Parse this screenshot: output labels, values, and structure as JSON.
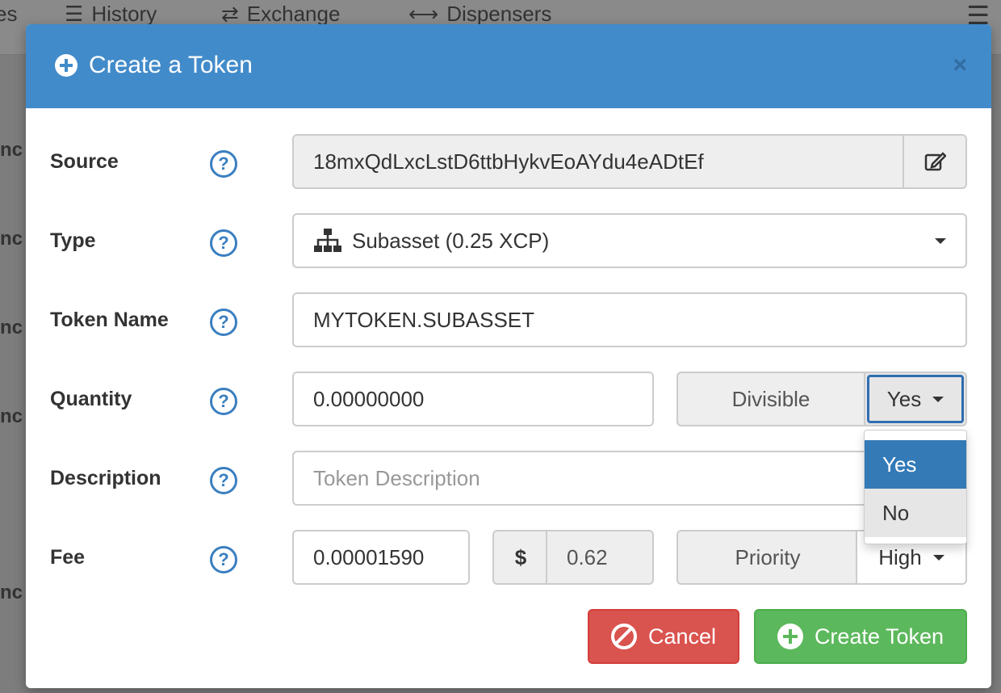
{
  "background": {
    "nav": [
      {
        "label": "es",
        "icon": ""
      },
      {
        "label": "History",
        "icon": "list-icon"
      },
      {
        "label": "Exchange",
        "icon": "exchange-icon"
      },
      {
        "label": "Dispensers",
        "icon": "arrows-horizontal-icon"
      }
    ],
    "side_labels": [
      "nc",
      "nc",
      "nc",
      "nc",
      "nc",
      "nc"
    ]
  },
  "modal": {
    "title": "Create a Token",
    "close": "×",
    "fields": {
      "source": {
        "label": "Source",
        "value": "18mxQdLxcLstD6ttbHykvEoAYdu4eADtEf"
      },
      "type": {
        "label": "Type",
        "value": "Subasset (0.25 XCP)"
      },
      "token_name": {
        "label": "Token Name",
        "value": "MYTOKEN.SUBASSET"
      },
      "quantity": {
        "label": "Quantity",
        "value": "0.00000000",
        "divisible_label": "Divisible",
        "divisible_value": "Yes"
      },
      "description": {
        "label": "Description",
        "placeholder": "Token Description"
      },
      "fee": {
        "label": "Fee",
        "value": "0.00001590",
        "currency_symbol": "$",
        "usd_value": "0.62",
        "priority_label": "Priority",
        "priority_value": "High"
      }
    },
    "divisible_dropdown": {
      "options": [
        "Yes",
        "No"
      ],
      "selected": "Yes"
    },
    "buttons": {
      "cancel": "Cancel",
      "create": "Create Token"
    }
  },
  "colors": {
    "header": "#428bca",
    "cancel": "#d9534f",
    "create": "#5cb85c",
    "help": "#3a7fc0"
  }
}
